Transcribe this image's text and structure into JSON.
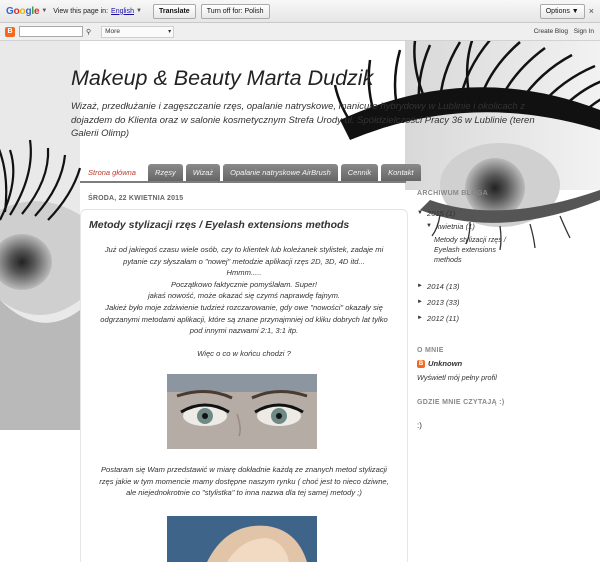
{
  "translate_bar": {
    "logo": "Google",
    "text": "View this page in:",
    "language": "English",
    "translate_button": "Translate",
    "turn_off_button": "Turn off for: Polish",
    "options_button": "Options ▼",
    "close_label": "×"
  },
  "navbar": {
    "more_label": "More",
    "create_blog": "Create Blog",
    "sign_in": "Sign In"
  },
  "header": {
    "title": "Makeup & Beauty Marta Dudzik",
    "description": "Wizaż, przedłużanie i zagęszczanie rzęs, opalanie natryskowe, manicure hybrydowy w Lublinie i okolicach z dojazdem do Klienta oraz w salonie kosmetycznym Strefa Urody ul. Spółdzielczości Pracy 36 w Lublinie (teren Galerii Olimp)"
  },
  "tabs": [
    {
      "label": "Strona główna",
      "active": true
    },
    {
      "label": "Rzęsy",
      "active": false
    },
    {
      "label": "Wizaż",
      "active": false
    },
    {
      "label": "Opalanie natryskowe AirBrush",
      "active": false
    },
    {
      "label": "Cennik",
      "active": false
    },
    {
      "label": "Kontakt",
      "active": false
    }
  ],
  "post": {
    "date": "ŚRODA, 22 KWIETNIA 2015",
    "title": "Metody stylizacji rzęs / Eyelash extensions methods",
    "lines_1": [
      "Już od jakiegoś czasu wiele osób, czy to klientek lub koleżanek stylistek,  zadaje mi pytanie czy słyszałam o \"nowej\" metodzie aplikacji rzęs 2D, 3D, 4D itd...",
      "Hmmm.....",
      "Początkowo faktycznie pomyślałam. Super!",
      "jakaś nowość, może okazać się czymś naprawdę fajnym.",
      "Jakież było moje zdziwienie tudzież rozczarowanie, gdy owe \"nowości\" okazały się odgrzanymi metodami aplikacji, które są znane przynajmniej od kliku dobrych lat tylko pod innymi nazwami 2:1, 3:1 itp."
    ],
    "question": "Więc o co w końcu chodzi ?",
    "lines_2": "Postaram się Wam przedstawić w miarę dokładnie każdą ze znanych metod stylizacji rzęs jakie w tym momencie mamy dostępne naszym rynku ( choć jest to nieco dziwne, ale niejednokrotnie co \"stylistka\" to inna nazwa dla tej samej metody ;)"
  },
  "sidebar": {
    "archive_title": "ARCHIWUM BLOGA",
    "year_2015": "2015",
    "count_2015": "(1)",
    "month": "kwietnia",
    "count_month": "(1)",
    "archive_post": "Metody stylizacji rzęs / Eyelash extensions methods",
    "year_2014": "2014",
    "count_2014": "(13)",
    "year_2013": "2013",
    "count_2013": "(33)",
    "year_2012": "2012",
    "count_2012": "(11)",
    "about_title": "O MNIE",
    "profile_name": "Unknown",
    "profile_link": "Wyświetl mój pełny profil",
    "read_title": "GDZIE MNIE CZYTAJĄ :)",
    "read_content": ":)"
  },
  "colors": {
    "tab_active": "#c0392b",
    "tab_bg": "#777777",
    "blogger_orange": "#f26a22"
  }
}
